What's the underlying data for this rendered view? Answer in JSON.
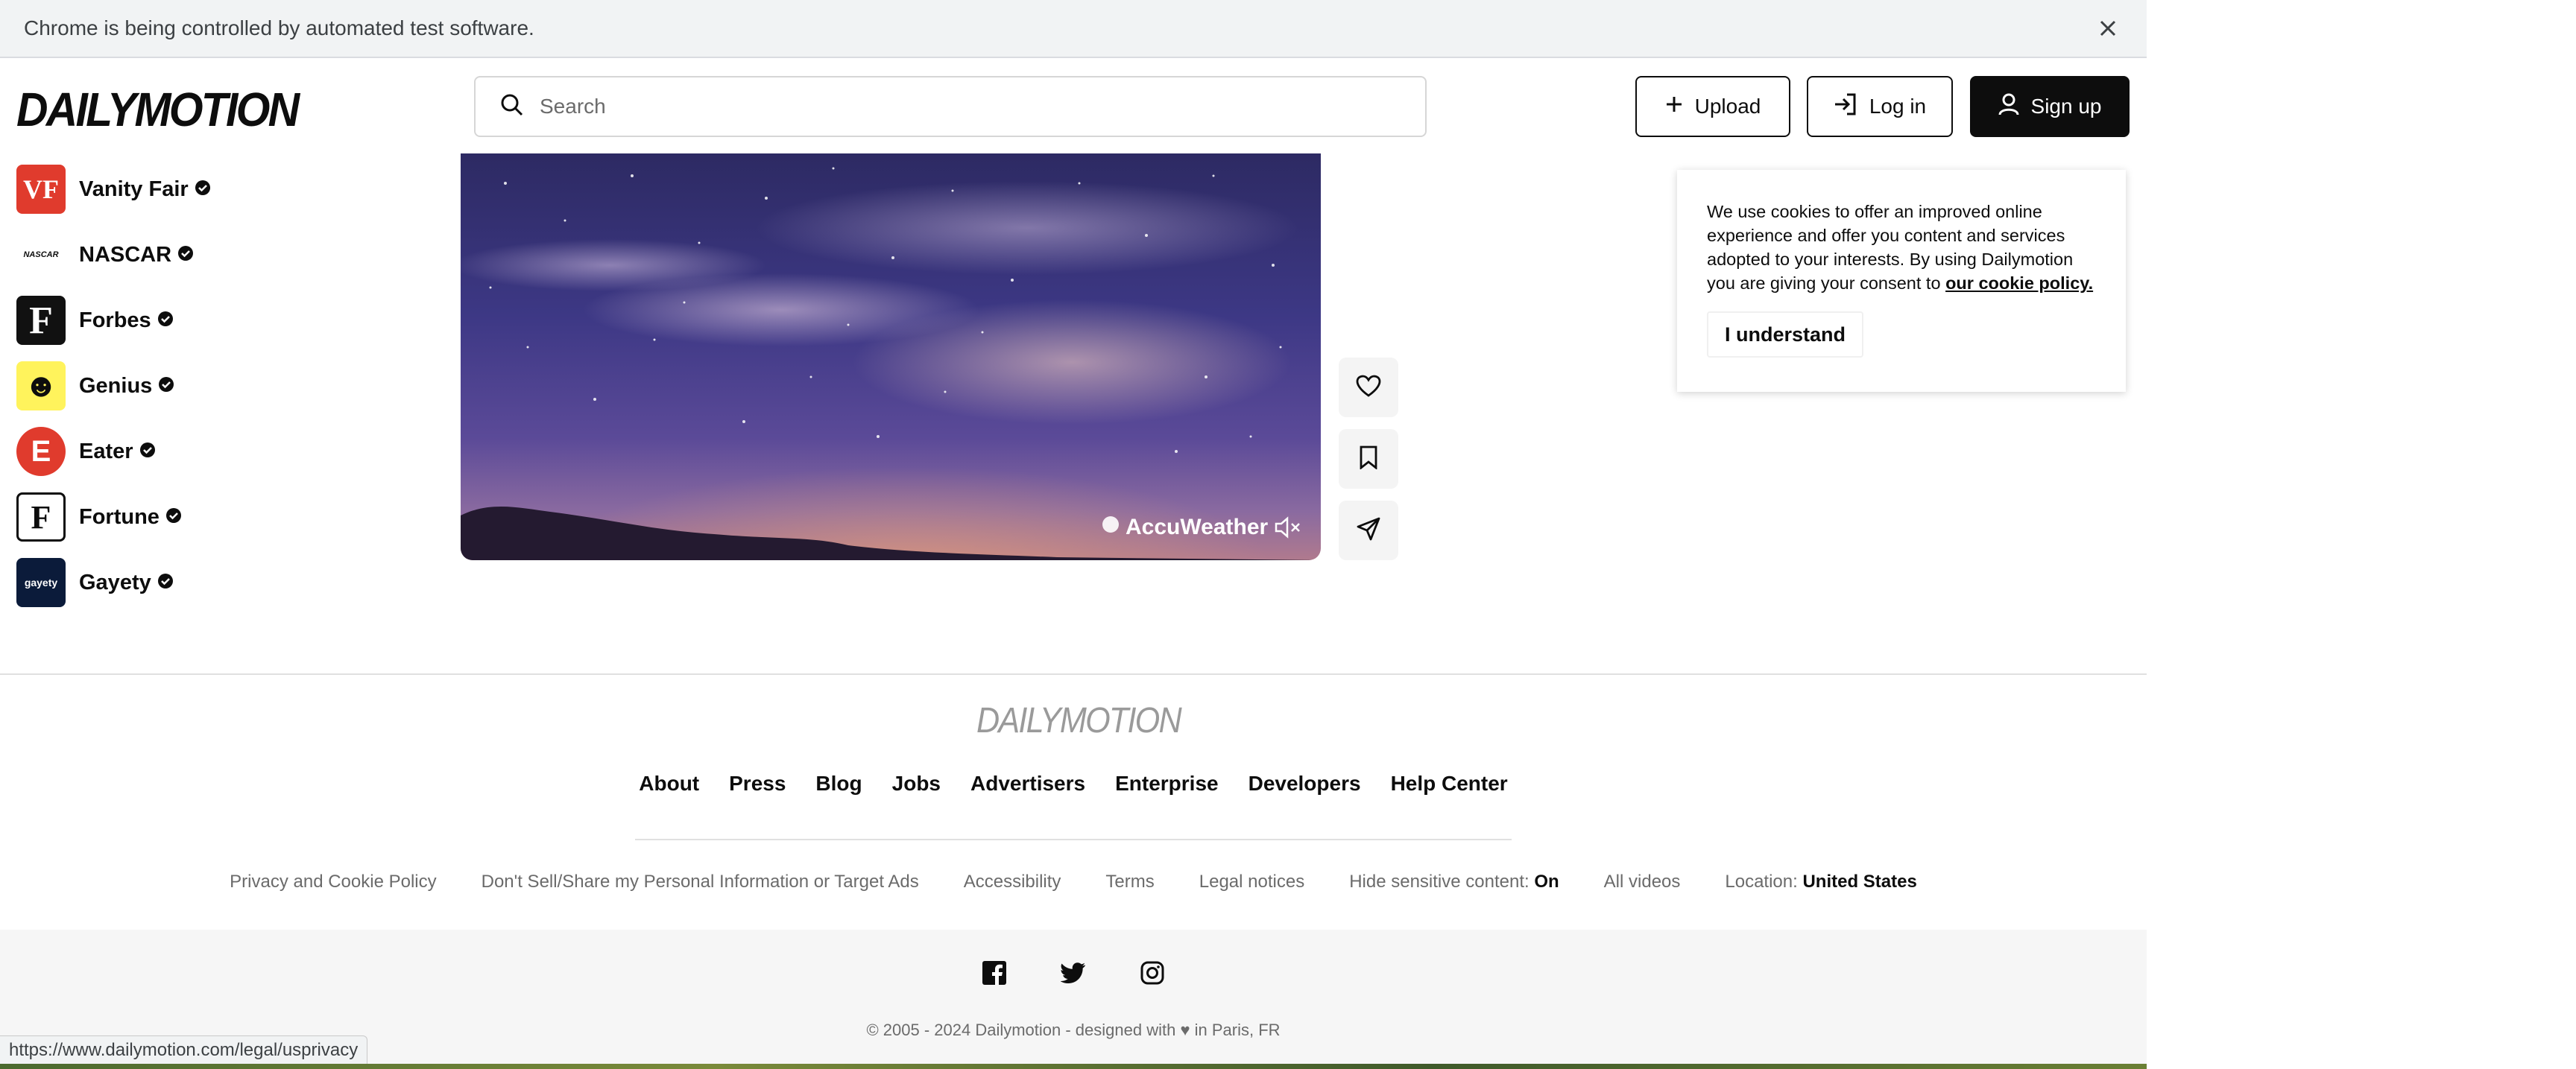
{
  "infobar": {
    "message": "Chrome is being controlled by automated test software."
  },
  "header": {
    "logo": "DAILYMOTION",
    "search_placeholder": "Search",
    "upload_label": "Upload",
    "login_label": "Log in",
    "signup_label": "Sign up"
  },
  "channels": [
    {
      "name": "Vanity Fair",
      "avatar_text": "VF",
      "color": "#e03b2d"
    },
    {
      "name": "NASCAR",
      "avatar_text": "NASCAR",
      "color": "#ffffff"
    },
    {
      "name": "Forbes",
      "avatar_text": "F",
      "color": "#111111"
    },
    {
      "name": "Genius",
      "avatar_text": "☻",
      "color": "#fff35c"
    },
    {
      "name": "Eater",
      "avatar_text": "E",
      "color": "#e03b2d"
    },
    {
      "name": "Fortune",
      "avatar_text": "F",
      "color": "#ffffff"
    },
    {
      "name": "Gayety",
      "avatar_text": "gayety",
      "color": "#0b1b3a"
    }
  ],
  "video": {
    "brand": "AccuWeather"
  },
  "cookie": {
    "text": "We use cookies to offer an improved online experience and offer you content and services adopted to your interests. By using Dailymotion you are giving your consent to ",
    "link": "our cookie policy.",
    "button": "I understand"
  },
  "footer": {
    "logo": "DAILYMOTION",
    "links": [
      "About",
      "Press",
      "Blog",
      "Jobs",
      "Advertisers",
      "Enterprise",
      "Developers",
      "Help Center"
    ],
    "legal": {
      "privacy": "Privacy and Cookie Policy",
      "dont_sell": "Don't Sell/Share my Personal Information or Target Ads",
      "accessibility": "Accessibility",
      "terms": "Terms",
      "legal_notices": "Legal notices",
      "sensitive_label": "Hide sensitive content:",
      "sensitive_value": "On",
      "all_videos": "All videos",
      "location_label": "Location:",
      "location_value": "United States"
    },
    "copyright": "© 2005 - 2024 Dailymotion - designed with ♥ in Paris, FR"
  },
  "status_url": "https://www.dailymotion.com/legal/usprivacy",
  "colors": {
    "accent": "#0d0d0d",
    "infobar_bg": "#f1f3f4"
  },
  "icons": [
    "close-icon",
    "search-icon",
    "plus-icon",
    "login-icon",
    "user-icon",
    "verified-icon",
    "heart-icon",
    "bookmark-icon",
    "share-icon",
    "mute-icon",
    "facebook-icon",
    "twitter-icon",
    "instagram-icon"
  ]
}
